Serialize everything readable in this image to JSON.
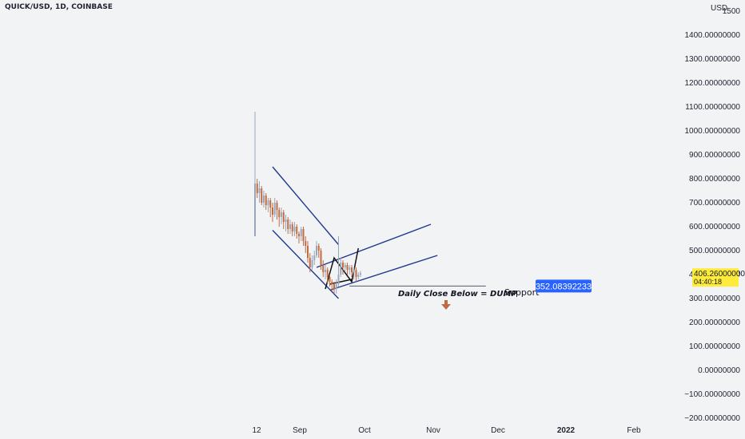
{
  "header": {
    "symbol": "QUICK/USD, 1D, COINBASE"
  },
  "colors": {
    "background": "#f2f3f5",
    "channel": "#1e3a8f",
    "pattern": "#111111",
    "candle_up": "#9aa6ba",
    "candle_down": "#c06b42",
    "price_badge": "#ffeb3b",
    "support_badge": "#2962ff",
    "arrow": "#c06b42"
  },
  "chart_data": {
    "type": "candlestick",
    "y_axis_unit": "USD",
    "ylim": [
      -200,
      1500
    ],
    "ytick_labels": [
      "1500",
      "1400.00000000",
      "1300.00000000",
      "1200.00000000",
      "1100.00000000",
      "1000.00000000",
      "900.00000000",
      "800.00000000",
      "700.00000000",
      "600.00000000",
      "500.00000000",
      "400.00000000",
      "300.00000000",
      "200.00000000",
      "100.00000000",
      "0.00000000",
      "−100.00000000",
      "−200.00000000"
    ],
    "ytick_values": [
      1500,
      1400,
      1300,
      1200,
      1100,
      1000,
      900,
      800,
      700,
      600,
      500,
      400,
      300,
      200,
      100,
      0,
      -100,
      -200
    ],
    "xtick_labels": [
      "12",
      "Sep",
      "Oct",
      "Nov",
      "Dec",
      "2022",
      "Feb"
    ],
    "xtick_bold": [
      "2022"
    ],
    "current_price": "406.26000000",
    "current_price_value": 406.26,
    "countdown": "04:40:18",
    "support_label": "352.08392233",
    "support_value": 352.08,
    "annotations": {
      "daily_close": "Daily Close Below = DUMP",
      "support": "Support"
    },
    "candles": [
      [
        560,
        780,
        580,
        1080
      ],
      [
        780,
        740,
        720,
        800
      ],
      [
        740,
        760,
        700,
        790
      ],
      [
        760,
        700,
        690,
        770
      ],
      [
        700,
        730,
        680,
        750
      ],
      [
        730,
        690,
        670,
        740
      ],
      [
        690,
        710,
        660,
        720
      ],
      [
        710,
        680,
        640,
        720
      ],
      [
        680,
        650,
        620,
        700
      ],
      [
        650,
        700,
        640,
        720
      ],
      [
        700,
        670,
        630,
        710
      ],
      [
        670,
        640,
        600,
        680
      ],
      [
        640,
        660,
        610,
        680
      ],
      [
        660,
        620,
        590,
        670
      ],
      [
        620,
        630,
        580,
        650
      ],
      [
        630,
        590,
        570,
        640
      ],
      [
        590,
        610,
        570,
        630
      ],
      [
        610,
        580,
        560,
        620
      ],
      [
        580,
        600,
        560,
        620
      ],
      [
        600,
        570,
        550,
        610
      ],
      [
        570,
        560,
        530,
        580
      ],
      [
        560,
        590,
        540,
        600
      ],
      [
        590,
        540,
        520,
        600
      ],
      [
        540,
        520,
        490,
        560
      ],
      [
        520,
        470,
        450,
        540
      ],
      [
        470,
        430,
        410,
        490
      ],
      [
        430,
        460,
        420,
        480
      ],
      [
        460,
        480,
        440,
        500
      ],
      [
        480,
        520,
        470,
        540
      ],
      [
        520,
        500,
        470,
        530
      ],
      [
        500,
        440,
        420,
        510
      ],
      [
        440,
        410,
        390,
        460
      ],
      [
        410,
        420,
        380,
        440
      ],
      [
        420,
        390,
        360,
        430
      ],
      [
        390,
        370,
        350,
        400
      ],
      [
        370,
        360,
        330,
        380
      ],
      [
        360,
        340,
        320,
        370
      ],
      [
        340,
        360,
        320,
        380
      ],
      [
        360,
        400,
        350,
        560
      ],
      [
        400,
        450,
        390,
        470
      ],
      [
        450,
        430,
        400,
        460
      ],
      [
        430,
        440,
        410,
        450
      ],
      [
        440,
        420,
        400,
        450
      ],
      [
        420,
        430,
        400,
        440
      ],
      [
        430,
        410,
        390,
        440
      ],
      [
        410,
        420,
        380,
        430
      ],
      [
        420,
        390,
        370,
        430
      ],
      [
        390,
        400,
        380,
        410
      ],
      [
        400,
        406,
        390,
        415
      ]
    ],
    "drawings": {
      "channel_upper": [
        [
          8,
          850
        ],
        [
          38,
          525
        ]
      ],
      "channel_lower": [
        [
          8,
          585
        ],
        [
          38,
          300
        ]
      ],
      "channel2_upper": [
        [
          28,
          430
        ],
        [
          80,
          610
        ]
      ],
      "channel2_lower": [
        [
          34,
          335
        ],
        [
          83,
          480
        ]
      ],
      "pattern": [
        [
          32,
          340
        ],
        [
          36,
          470
        ],
        [
          44,
          370
        ],
        [
          47,
          510
        ]
      ],
      "pattern_base": [
        [
          34,
          360
        ],
        [
          44,
          380
        ]
      ],
      "support_line": [
        [
          43,
          352.08
        ],
        [
          105,
          352.08
        ]
      ]
    }
  }
}
